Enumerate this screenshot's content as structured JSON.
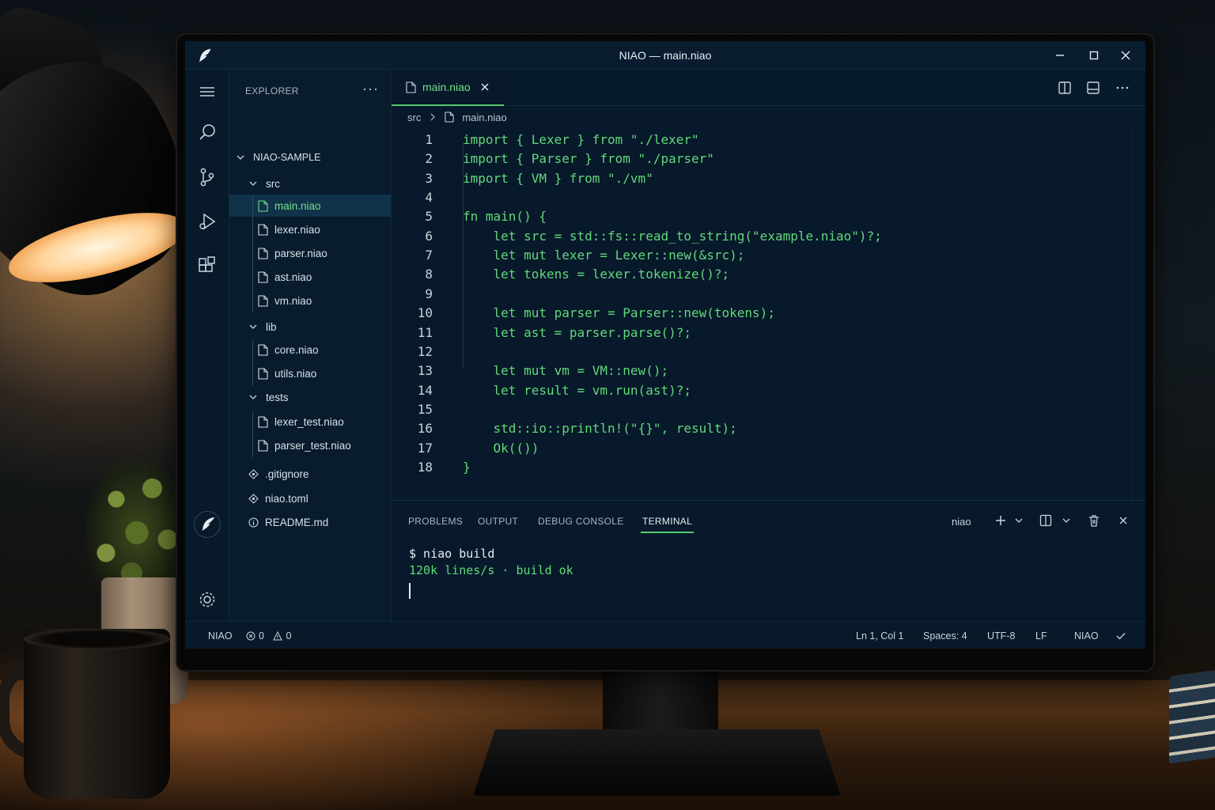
{
  "window": {
    "title": "NIAO — main.niao"
  },
  "sidebar": {
    "header": "EXPLORER",
    "more": "···",
    "tree": [
      {
        "label": "NIAO-SAMPLE",
        "kind": "root"
      },
      {
        "label": "src",
        "kind": "folder"
      },
      {
        "label": "main.niao",
        "kind": "file",
        "selected": true
      },
      {
        "label": "lexer.niao",
        "kind": "file"
      },
      {
        "label": "parser.niao",
        "kind": "file"
      },
      {
        "label": "ast.niao",
        "kind": "file"
      },
      {
        "label": "vm.niao",
        "kind": "file"
      },
      {
        "label": "lib",
        "kind": "folder"
      },
      {
        "label": "core.niao",
        "kind": "file"
      },
      {
        "label": "utils.niao",
        "kind": "file"
      },
      {
        "label": "tests",
        "kind": "folder"
      },
      {
        "label": "lexer_test.niao",
        "kind": "file"
      },
      {
        "label": "parser_test.niao",
        "kind": "file"
      },
      {
        "label": ".gitignore",
        "kind": "config"
      },
      {
        "label": "niao.toml",
        "kind": "config"
      },
      {
        "label": "README.md",
        "kind": "info"
      }
    ]
  },
  "editor": {
    "tab": {
      "label": "main.niao",
      "active": true
    },
    "breadcrumb": {
      "folder": "src",
      "file": "main.niao"
    },
    "lines": [
      {
        "n": "1",
        "code": "import { Lexer } from \"./lexer\""
      },
      {
        "n": "2",
        "code": "import { Parser } from \"./parser\""
      },
      {
        "n": "3",
        "code": "import { VM } from \"./vm\""
      },
      {
        "n": "4",
        "code": ""
      },
      {
        "n": "5",
        "code": "fn main() {"
      },
      {
        "n": "6",
        "code": "    let src = std::fs::read_to_string(\"example.niao\")?;"
      },
      {
        "n": "7",
        "code": "    let mut lexer = Lexer::new(&src);"
      },
      {
        "n": "8",
        "code": "    let tokens = lexer.tokenize()?;"
      },
      {
        "n": "9",
        "code": ""
      },
      {
        "n": "10",
        "code": "    let mut parser = Parser::new(tokens);"
      },
      {
        "n": "11",
        "code": "    let ast = parser.parse()?;"
      },
      {
        "n": "12",
        "code": ""
      },
      {
        "n": "13",
        "code": "    let mut vm = VM::new();"
      },
      {
        "n": "14",
        "code": "    let result = vm.run(ast)?;"
      },
      {
        "n": "15",
        "code": ""
      },
      {
        "n": "16",
        "code": "    std::io::println!(\"{}\", result);"
      },
      {
        "n": "17",
        "code": "    Ok(())"
      },
      {
        "n": "18",
        "code": "}"
      }
    ]
  },
  "panel": {
    "tabs": [
      {
        "label": "PROBLEMS",
        "active": false
      },
      {
        "label": "OUTPUT",
        "active": false
      },
      {
        "label": "DEBUG CONSOLE",
        "active": false
      },
      {
        "label": "TERMINAL",
        "active": true
      }
    ],
    "terminal_profile": "niao",
    "terminal_lines": [
      "$ niao build",
      "120k lines/s · build ok"
    ]
  },
  "statusbar": {
    "language_left": "NIAO",
    "errors": "0",
    "warnings": "0",
    "position": "Ln 1, Col 1",
    "spaces": "Spaces: 4",
    "encoding": "UTF-8",
    "eol": "LF",
    "language": "NIAO"
  },
  "colors": {
    "accent_green": "#63d87c",
    "background": "#07192a",
    "selection": "#10334a"
  }
}
